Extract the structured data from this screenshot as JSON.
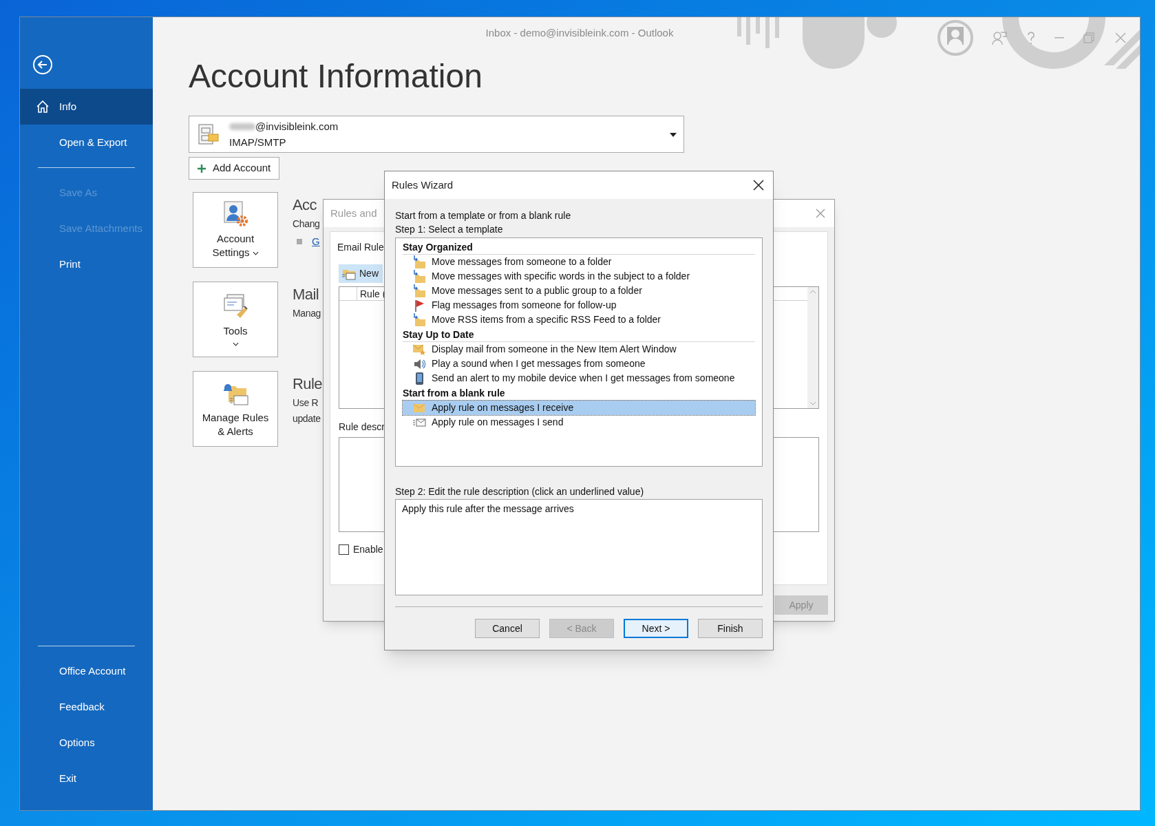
{
  "window": {
    "title": "Inbox - demo@invisibleink.com - Outlook"
  },
  "sidebar": {
    "primary_items": [
      {
        "label": "Info",
        "selected": true,
        "disabled": false
      },
      {
        "label": "Open & Export",
        "selected": false,
        "disabled": false
      }
    ],
    "file_items": [
      {
        "label": "Save As",
        "selected": false,
        "disabled": true
      },
      {
        "label": "Save Attachments",
        "selected": false,
        "disabled": true
      },
      {
        "label": "Print",
        "selected": false,
        "disabled": false
      }
    ],
    "footer_items": [
      {
        "label": "Office Account",
        "selected": false,
        "disabled": false
      },
      {
        "label": "Feedback",
        "selected": false,
        "disabled": false
      },
      {
        "label": "Options",
        "selected": false,
        "disabled": false
      },
      {
        "label": "Exit",
        "selected": false,
        "disabled": false
      }
    ]
  },
  "page": {
    "heading": "Account Information",
    "account": {
      "email": "@invisibleink.com",
      "type": "IMAP/SMTP"
    },
    "add_account": "Add Account",
    "tiles": [
      {
        "label": "Account Settings",
        "kind": "dropdown_inline"
      },
      {
        "label": "Tools",
        "kind": "dropdown_below"
      },
      {
        "label": "Manage Rules & Alerts",
        "kind": "button"
      }
    ],
    "sections": [
      {
        "title": "Acc",
        "lines": [
          "Chang"
        ],
        "link": "G"
      },
      {
        "title": "Mail",
        "lines": [
          "Manag"
        ]
      },
      {
        "title": "Rule",
        "lines": [
          "Use R",
          "update"
        ]
      }
    ]
  },
  "rules_and_alerts": {
    "title": "Rules and",
    "tab": "Email Rule",
    "new_button": "New",
    "column": "Rule (",
    "description_label": "Rule descr",
    "enable": {
      "label": "Enable",
      "checked": false
    },
    "apply": {
      "label": "Apply",
      "disabled": true
    }
  },
  "rules_wizard": {
    "title": "Rules Wizard",
    "intro": "Start from a template or from a blank rule",
    "step1": "Step 1: Select a template",
    "groups": [
      {
        "title": "Stay Organized",
        "items": [
          {
            "label": "Move messages from someone to a folder",
            "kind": "folder_move",
            "selected": false
          },
          {
            "label": "Move messages with specific words in the subject to a folder",
            "kind": "folder_move",
            "selected": false
          },
          {
            "label": "Move messages sent to a public group to a folder",
            "kind": "folder_move",
            "selected": false
          },
          {
            "label": "Flag messages from someone for follow-up",
            "kind": "flag",
            "selected": false
          },
          {
            "label": "Move RSS items from a specific RSS Feed to a folder",
            "kind": "folder_move",
            "selected": false
          }
        ]
      },
      {
        "title": "Stay Up to Date",
        "items": [
          {
            "label": "Display mail from someone in the New Item Alert Window",
            "kind": "mail_star",
            "selected": false
          },
          {
            "label": "Play a sound when I get messages from someone",
            "kind": "speaker",
            "selected": false
          },
          {
            "label": "Send an alert to my mobile device when I get messages from someone",
            "kind": "phone",
            "selected": false
          }
        ]
      },
      {
        "title": "Start from a blank rule",
        "items": [
          {
            "label": "Apply rule on messages I receive",
            "kind": "envelope",
            "selected": true
          },
          {
            "label": "Apply rule on messages I send",
            "kind": "envelope_send",
            "selected": false
          }
        ]
      }
    ],
    "step2": "Step 2: Edit the rule description (click an underlined value)",
    "description": "Apply this rule after the message arrives",
    "buttons": [
      {
        "label": "Cancel",
        "kind": "normal"
      },
      {
        "label": "< Back",
        "kind": "disabled"
      },
      {
        "label": "Next >",
        "kind": "default"
      },
      {
        "label": "Finish",
        "kind": "normal"
      }
    ]
  }
}
